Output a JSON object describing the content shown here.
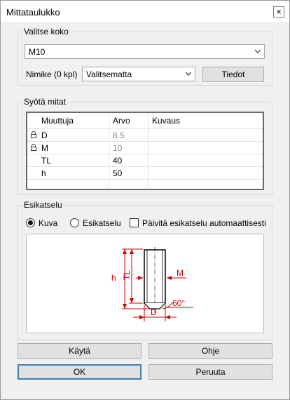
{
  "window": {
    "title": "Mittataulukko",
    "close_glyph": "×"
  },
  "size_group": {
    "legend": "Valitse koko",
    "size_value": "M10",
    "name_label": "Nimike (0 kpl)",
    "name_value": "Valitsematta",
    "details_button": "Tiedot"
  },
  "dims_group": {
    "legend": "Syötä mitat",
    "headers": [
      "Muuttuja",
      "Arvo",
      "Kuvaus"
    ],
    "rows": [
      {
        "name": "D",
        "value": "8.5",
        "desc": "",
        "locked": true
      },
      {
        "name": "M",
        "value": "10",
        "desc": "",
        "locked": true
      },
      {
        "name": "TL",
        "value": "40",
        "desc": "",
        "locked": false
      },
      {
        "name": "h",
        "value": "50",
        "desc": "",
        "locked": false
      }
    ]
  },
  "preview_group": {
    "legend": "Esikatselu",
    "option_image": "Kuva",
    "option_preview": "Esikatselu",
    "selected_option": "Kuva",
    "auto_update_label": "Päivitä esikatselu automaattisesti",
    "auto_update_checked": false,
    "drawing_labels": {
      "h": "h",
      "TL": "TL",
      "M": "M",
      "D": "D",
      "angle": "60°"
    }
  },
  "buttons": {
    "apply": "Käytä",
    "help": "Ohje",
    "ok": "OK",
    "cancel": "Peruuta"
  },
  "colors": {
    "drawing_red": "#d00000",
    "accent_border": "#3c7fb1"
  }
}
